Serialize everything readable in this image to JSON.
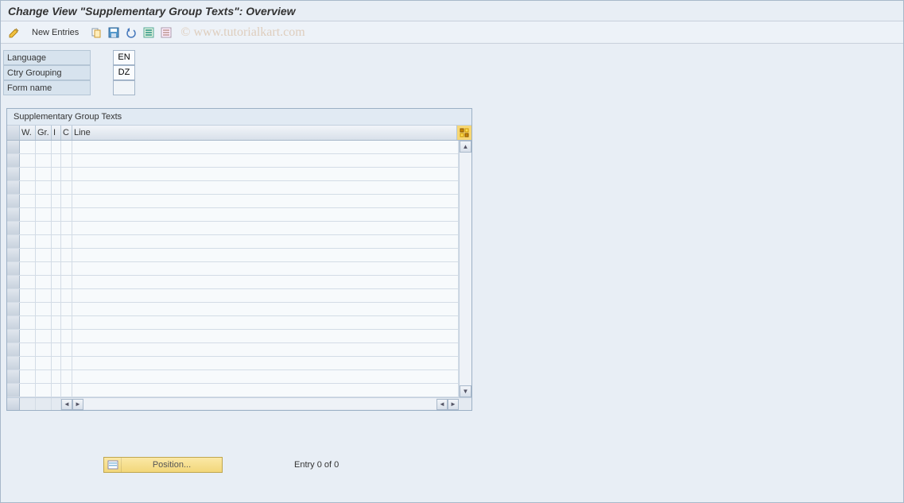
{
  "title": "Change View \"Supplementary Group Texts\": Overview",
  "toolbar": {
    "new_entries": "New Entries"
  },
  "watermark": "© www.tutorialkart.com",
  "form": {
    "language_label": "Language",
    "language_value": "EN",
    "ctry_label": "Ctry Grouping",
    "ctry_value": "DZ",
    "formname_label": "Form name",
    "formname_value": ""
  },
  "table": {
    "title": "Supplementary Group Texts",
    "columns": {
      "w": "W.",
      "gr": "Gr.",
      "i": "I",
      "c": "C",
      "line": "Line"
    },
    "rows": [
      {},
      {},
      {},
      {},
      {},
      {},
      {},
      {},
      {},
      {},
      {},
      {},
      {},
      {},
      {},
      {},
      {},
      {},
      {}
    ]
  },
  "footer": {
    "position_label": "Position...",
    "entry_text": "Entry 0 of 0"
  }
}
